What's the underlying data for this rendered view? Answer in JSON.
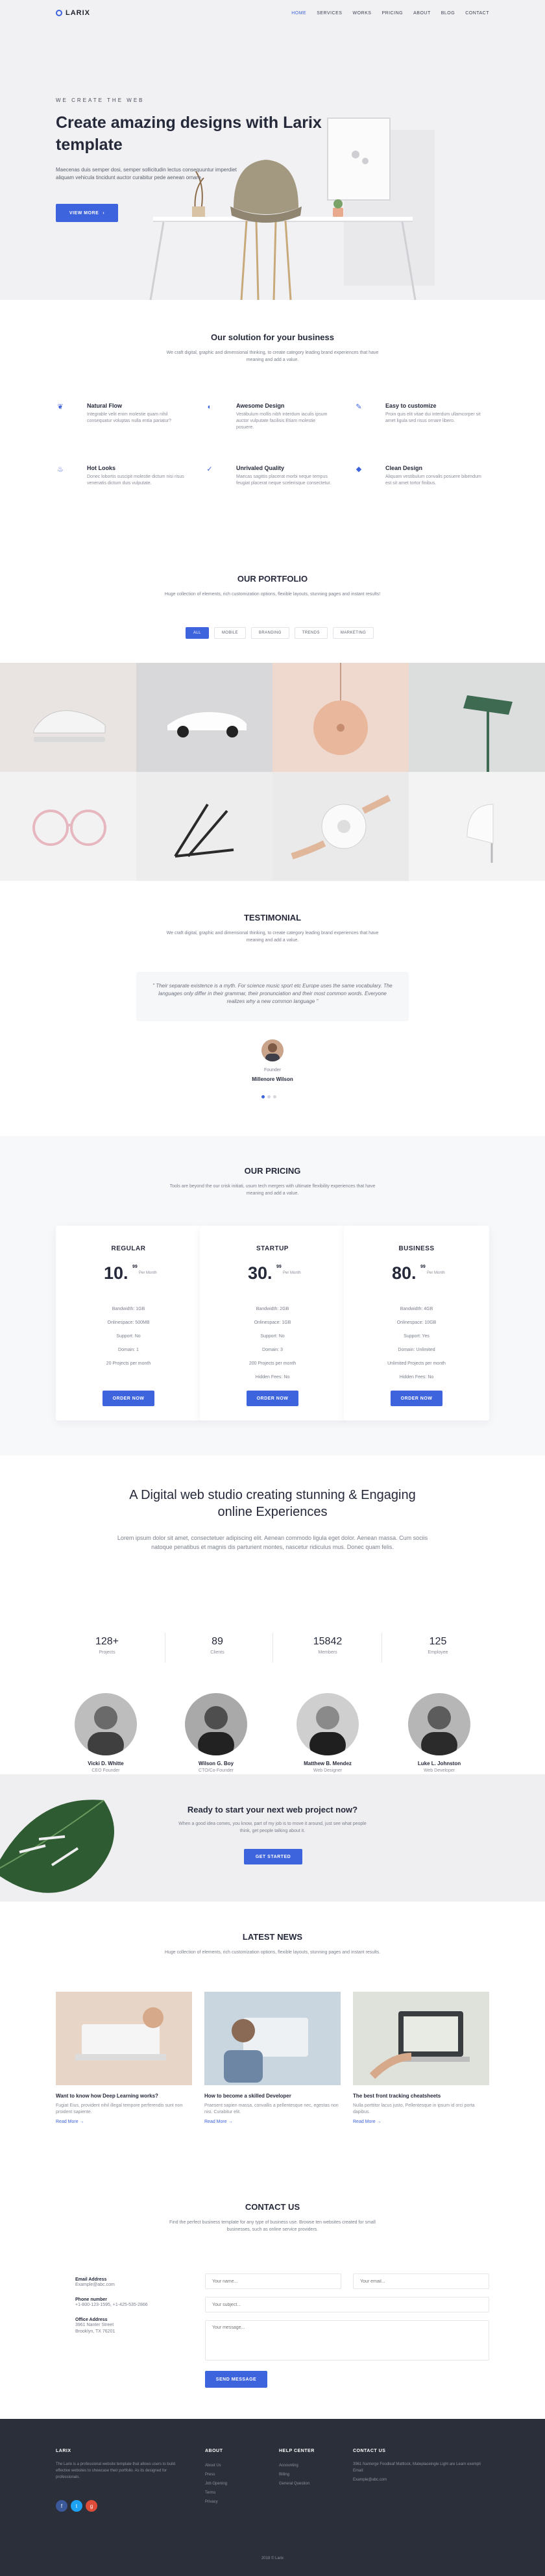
{
  "nav": {
    "brand": "LARIX",
    "links": [
      "HOME",
      "SERVICES",
      "WORKS",
      "PRICING",
      "ABOUT",
      "BLOG",
      "CONTACT"
    ]
  },
  "hero": {
    "kicker": "WE CREATE THE WEB",
    "title": "Create amazing designs with Larix template",
    "text": "Maecenas duis semper dosi, semper sollicitudin lectus consequuntur imperdiet aliquam vehicula tincidunt auctor curabitur pede aenean ornare.",
    "button": "VIEW MORE",
    "button_icon": "arrow-right-icon"
  },
  "solution": {
    "title": "Our solution for your business",
    "subtitle": "We craft digital, graphic and dimensional thinking, to create category leading brand experiences that have meaning and add a value.",
    "features": [
      {
        "icon": "leaf-icon",
        "title": "Natural Flow",
        "text": "Integrable velit enim molestie quam nihil consequatur voluptas nulla entia pariatur?"
      },
      {
        "icon": "palette-icon",
        "title": "Awesome Design",
        "text": "Vestibulum mollis nibh interdum iaculis ipsum auctor vulputate facilisis Etiam molestie posuere."
      },
      {
        "icon": "wrench-icon",
        "title": "Easy to customize",
        "text": "Proin quis elit vitae dui interdum ullamcorper sit amet ligula sed risus ornare libero."
      },
      {
        "icon": "flame-icon",
        "title": "Hot Looks",
        "text": "Donec lobortis suscipit molestie dictum nisi risus venenatis dictum duis vulputate."
      },
      {
        "icon": "check-badge-icon",
        "title": "Unrivaled Quality",
        "text": "Maecas sagittis placerat morbi neque tempus feugiat placerat neque scelerisque consectetur."
      },
      {
        "icon": "gem-icon",
        "title": "Clean Design",
        "text": "Aliquam vestibulum convalis posuere bibendum est sit amet tortor finibus."
      }
    ]
  },
  "portfolio": {
    "title": "OUR PORTFOLIO",
    "subtitle": "Huge collection of elements, rich customization options, flexible layouts, stunning pages and instant results!",
    "filters": [
      "ALL",
      "MOBILE",
      "BRANDING",
      "TRENDS",
      "MARKETING"
    ],
    "items": [
      "sneaker",
      "toy-car",
      "pendant-lamp",
      "green-lamp",
      "glasses",
      "chair-legs",
      "mug-hands",
      "white-lamp"
    ]
  },
  "testimonial": {
    "title": "TESTIMONIAL",
    "subtitle": "We craft digital, graphic and dimensional thinking, to create category leading brand experiences that have meaning and add a value.",
    "quote": "\" Their separate existence is a myth. For science music sport etc Europe uses the same vocabulary. The languages only differ in their grammar, their pronunciation and their most common words. Everyone realizes why a new common language \"",
    "role": "Founder",
    "name": "Millenore Wilson"
  },
  "pricing": {
    "title": "OUR PRICING",
    "subtitle": "Tools are beyond the our crisk initiati, usum tech mergers with ultimate flexibility experiences that have meaning and add a value.",
    "plans": [
      {
        "name": "REGULAR",
        "price": "10.",
        "cents": "99",
        "currency": "$",
        "period": "Per Month",
        "features": [
          "Bandwidth: 1GB",
          "Onlinespace: 500MB",
          "Support: No",
          "Domain: 1",
          "20 Projects per month"
        ],
        "button": "ORDER NOW"
      },
      {
        "name": "STARTUP",
        "price": "30.",
        "cents": "99",
        "currency": "$",
        "period": "Per Month",
        "features": [
          "Bandwidth: 2GB",
          "Onlinespace: 1GB",
          "Support: No",
          "Domain: 3",
          "200 Projects per month",
          "Hidden Fees: No"
        ],
        "button": "ORDER NOW"
      },
      {
        "name": "BUSINESS",
        "price": "80.",
        "cents": "99",
        "currency": "$",
        "period": "Per Month",
        "features": [
          "Bandwidth: 4GB",
          "Onlinespace: 10GB",
          "Support: Yes",
          "Domain: Unlimited",
          "Unlimited Projects per month",
          "Hidden Fees: No"
        ],
        "button": "ORDER NOW"
      }
    ]
  },
  "studio": {
    "title": "A Digital web studio creating stunning & Engaging online Experiences",
    "text": "Lorem ipsum dolor sit amet, consectetuer adipiscing elit. Aenean commodo ligula eget dolor. Aenean massa. Cum sociis natoque penatibus et magnis dis parturient montes, nascetur ridiculus mus. Donec quam felis.",
    "stats": [
      {
        "value": "128+",
        "label": "Projects"
      },
      {
        "value": "89",
        "label": "Clients"
      },
      {
        "value": "15842",
        "label": "Members"
      },
      {
        "value": "125",
        "label": "Employee"
      }
    ],
    "team": [
      {
        "name": "Vicki D. Whitte",
        "role": "CEO Founder"
      },
      {
        "name": "Wilson G. Boy",
        "role": "CTO/Co-Founder"
      },
      {
        "name": "Matthew B. Mendez",
        "role": "Web Designer"
      },
      {
        "name": "Luke L. Johnston",
        "role": "Web Developer"
      }
    ]
  },
  "cta": {
    "title": "Ready to start your next web project now?",
    "text": "When a good idea comes, you know, part of my job is to move it around, just see what people think, get people talking about it.",
    "button": "GET STARTED"
  },
  "news": {
    "title": "LATEST NEWS",
    "subtitle": "Huge collection of elements, rich customization options, flexible layouts, stunning pages and instant results.",
    "posts": [
      {
        "title": "Want to know how Deep Learning works?",
        "text": "Fugiat Eius, provident nihil illegal tempore perferendis sunt non proident sapiente.",
        "link": "Read More"
      },
      {
        "title": "How to become a skilled Developer",
        "text": "Praesent sapien massa, convallis a pellentesque nec, egestas non nisi. Curabitur elit.",
        "link": "Read More"
      },
      {
        "title": "The best front tracking cheatsheets",
        "text": "Nulla porttitor lacus justo, Pellentesque in ipsum id orci porta dapibus.",
        "link": "Read More"
      }
    ]
  },
  "contact": {
    "title": "CONTACT US",
    "subtitle": "Find the perfect business template for any type of business use. Browse ten websites created for small businesses, such as online service providers.",
    "email_label": "Email Address",
    "email": "Example@abc.com",
    "phone_label": "Phone number",
    "phone": "+1-800-123-1595, +1-425-535-2866",
    "office_label": "Office Address",
    "office": "3961 Nanter Street\nBrooklyn, TX 76201",
    "name_placeholder": "Your name...",
    "email_placeholder": "Your email...",
    "subject_placeholder": "Your subject...",
    "message_placeholder": "Your message...",
    "button": "SEND MESSAGE"
  },
  "footer": {
    "brand": "LARIX",
    "brand_text": "The Larix is a professional website template that allows users to build effective websites to showcase their portfolio. As its designed for professionals.",
    "about_title": "ABOUT",
    "about_items": [
      "About Us",
      "Press",
      "Job Opening",
      "Terms",
      "Privacy"
    ],
    "help_title": "HELP CENTER",
    "help_items": [
      "Accounting",
      "Billing",
      "General Question"
    ],
    "contact_title": "CONTACT US",
    "contact_text": "3961 Nanterge Foodleaf Mattlock, Mateplaceingle Light are Learn exempli Email:",
    "contact_email": "Example@abc.com",
    "copyright": "2018 © Larix",
    "colors": {
      "facebook": "#3b5998",
      "twitter": "#1da1f2",
      "google": "#dd4b39"
    }
  }
}
